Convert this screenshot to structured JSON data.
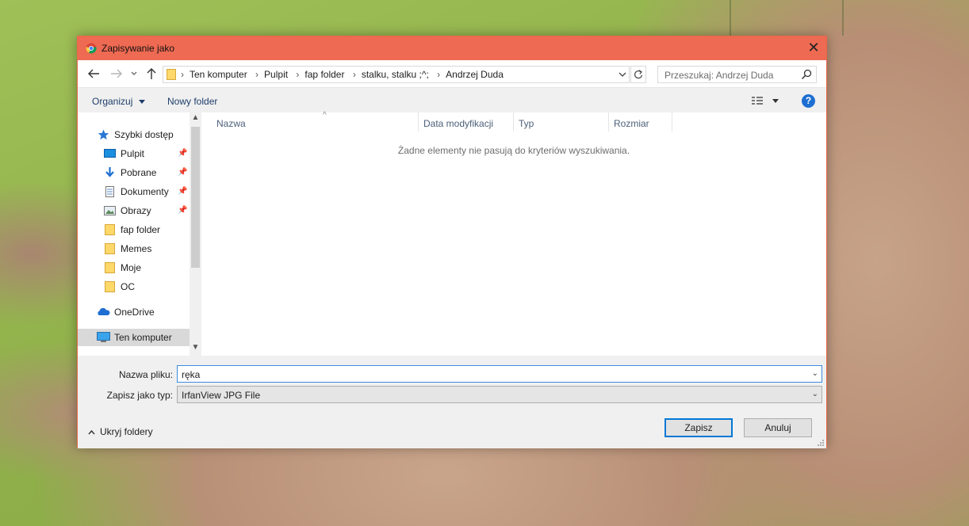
{
  "window": {
    "title": "Zapisywanie jako",
    "close_glyph": "✕"
  },
  "nav": {
    "breadcrumbs": [
      "Ten komputer",
      "Pulpit",
      "fap folder",
      "stalku, stalku ;^;",
      "Andrzej Duda"
    ],
    "breadcrumb_sep": "›",
    "search_placeholder": "Przeszukaj: Andrzej Duda"
  },
  "toolbar": {
    "organize_label": "Organizuj",
    "new_folder_label": "Nowy folder",
    "help_glyph": "?"
  },
  "sidebar": {
    "items": [
      {
        "label": "Szybki dostęp",
        "icon": "star-icon",
        "pinned": false
      },
      {
        "label": "Pulpit",
        "icon": "desktop-icon",
        "pinned": true
      },
      {
        "label": "Pobrane",
        "icon": "download-icon",
        "pinned": true
      },
      {
        "label": "Dokumenty",
        "icon": "documents-icon",
        "pinned": true
      },
      {
        "label": "Obrazy",
        "icon": "pictures-icon",
        "pinned": true
      },
      {
        "label": "fap folder",
        "icon": "folder-icon",
        "pinned": false
      },
      {
        "label": "Memes",
        "icon": "folder-icon",
        "pinned": false
      },
      {
        "label": "Moje",
        "icon": "folder-icon",
        "pinned": false
      },
      {
        "label": "OC",
        "icon": "folder-icon",
        "pinned": false
      },
      {
        "label": "OneDrive",
        "icon": "cloud-icon",
        "pinned": false
      },
      {
        "label": "Ten komputer",
        "icon": "computer-icon",
        "pinned": false,
        "selected": true
      }
    ]
  },
  "filelist": {
    "columns": [
      "Nazwa",
      "Data modyfikacji",
      "Typ",
      "Rozmiar"
    ],
    "empty_message": "Żadne elementy nie pasują do kryteriów wyszukiwania."
  },
  "footer": {
    "filename_label": "Nazwa pliku:",
    "filename_value": "ręka",
    "type_label": "Zapisz jako typ:",
    "type_value": "IrfanView JPG File",
    "hide_folders_label": "Ukryj foldery",
    "save_label": "Zapisz",
    "cancel_label": "Anuluj"
  },
  "colors": {
    "titlebar": "#ee6a52",
    "accent": "#0078d7",
    "folder": "#ffd86a"
  }
}
